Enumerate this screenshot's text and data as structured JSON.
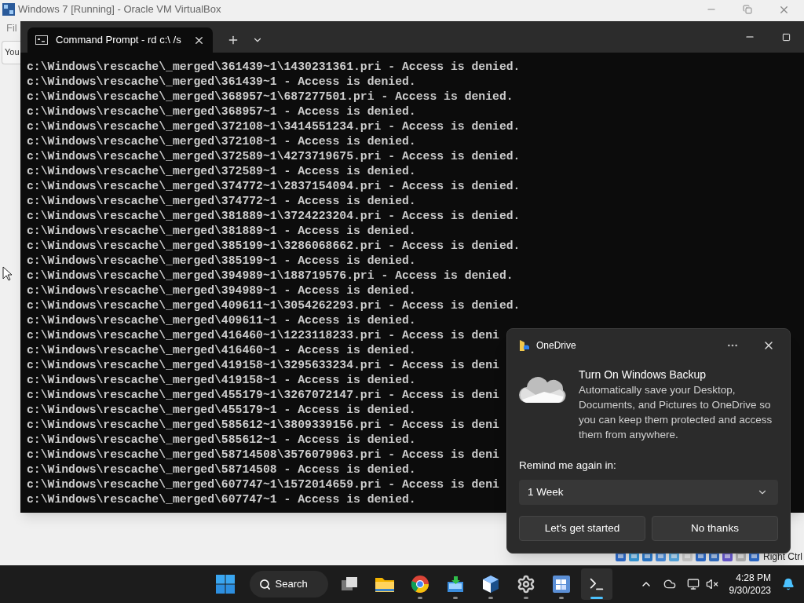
{
  "host_window": {
    "title": "Windows 7 [Running] - Oracle VM VirtualBox",
    "menu_item": "Fil",
    "toolbar_button": "You",
    "host_key": "Right Ctrl"
  },
  "terminal": {
    "tab_title": "Command Prompt - rd  c:\\ /s",
    "lines": [
      "c:\\Windows\\rescache\\_merged\\361439~1\\1430231361.pri - Access is denied.",
      "c:\\Windows\\rescache\\_merged\\361439~1 - Access is denied.",
      "c:\\Windows\\rescache\\_merged\\368957~1\\687277501.pri - Access is denied.",
      "c:\\Windows\\rescache\\_merged\\368957~1 - Access is denied.",
      "c:\\Windows\\rescache\\_merged\\372108~1\\3414551234.pri - Access is denied.",
      "c:\\Windows\\rescache\\_merged\\372108~1 - Access is denied.",
      "c:\\Windows\\rescache\\_merged\\372589~1\\4273719675.pri - Access is denied.",
      "c:\\Windows\\rescache\\_merged\\372589~1 - Access is denied.",
      "c:\\Windows\\rescache\\_merged\\374772~1\\2837154094.pri - Access is denied.",
      "c:\\Windows\\rescache\\_merged\\374772~1 - Access is denied.",
      "c:\\Windows\\rescache\\_merged\\381889~1\\3724223204.pri - Access is denied.",
      "c:\\Windows\\rescache\\_merged\\381889~1 - Access is denied.",
      "c:\\Windows\\rescache\\_merged\\385199~1\\3286068662.pri - Access is denied.",
      "c:\\Windows\\rescache\\_merged\\385199~1 - Access is denied.",
      "c:\\Windows\\rescache\\_merged\\394989~1\\188719576.pri - Access is denied.",
      "c:\\Windows\\rescache\\_merged\\394989~1 - Access is denied.",
      "c:\\Windows\\rescache\\_merged\\409611~1\\3054262293.pri - Access is denied.",
      "c:\\Windows\\rescache\\_merged\\409611~1 - Access is denied.",
      "c:\\Windows\\rescache\\_merged\\416460~1\\1223118233.pri - Access is deni",
      "c:\\Windows\\rescache\\_merged\\416460~1 - Access is denied.",
      "c:\\Windows\\rescache\\_merged\\419158~1\\3295633234.pri - Access is deni",
      "c:\\Windows\\rescache\\_merged\\419158~1 - Access is denied.",
      "c:\\Windows\\rescache\\_merged\\455179~1\\3267072147.pri - Access is deni",
      "c:\\Windows\\rescache\\_merged\\455179~1 - Access is denied.",
      "c:\\Windows\\rescache\\_merged\\585612~1\\3809339156.pri - Access is deni",
      "c:\\Windows\\rescache\\_merged\\585612~1 - Access is denied.",
      "c:\\Windows\\rescache\\_merged\\58714508\\3576079963.pri - Access is deni",
      "c:\\Windows\\rescache\\_merged\\58714508 - Access is denied.",
      "c:\\Windows\\rescache\\_merged\\607747~1\\1572014659.pri - Access is deni",
      "c:\\Windows\\rescache\\_merged\\607747~1 - Access is denied."
    ]
  },
  "notification": {
    "app": "OneDrive",
    "title": "Turn On Windows Backup",
    "body": "Automatically save your Desktop, Documents, and Pictures to OneDrive so you can keep them protected and access them from anywhere.",
    "remind_label": "Remind me again in:",
    "remind_value": "1 Week",
    "buttons": [
      "Let's get started",
      "No thanks"
    ]
  },
  "taskbar": {
    "search": "Search",
    "apps": [
      {
        "kind": "taskview",
        "running": false,
        "selected": false
      },
      {
        "kind": "folder",
        "running": false,
        "selected": false
      },
      {
        "kind": "browser",
        "running": true,
        "selected": false
      },
      {
        "kind": "installer",
        "running": true,
        "selected": false
      },
      {
        "kind": "cube",
        "running": true,
        "selected": false
      },
      {
        "kind": "gear",
        "running": true,
        "selected": false
      },
      {
        "kind": "vm",
        "running": true,
        "selected": false
      },
      {
        "kind": "terminal",
        "running": true,
        "selected": true
      }
    ],
    "time": "4:28 PM",
    "date": "9/30/2023"
  }
}
